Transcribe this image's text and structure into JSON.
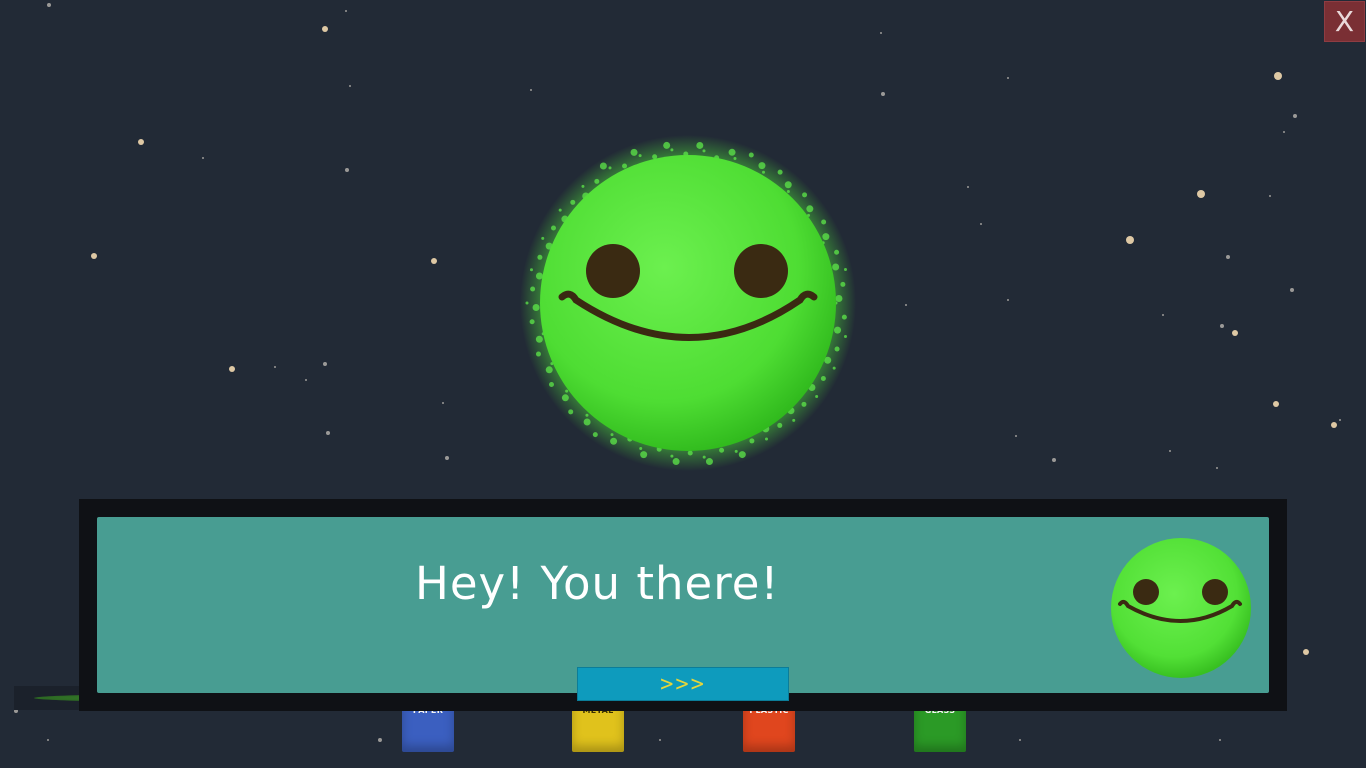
{
  "close_button": {
    "label": "X"
  },
  "dialog": {
    "message": "Hey! You there!",
    "next_label": ">>>"
  },
  "bins": [
    {
      "label": "PAPER",
      "color": "#3b5fc0"
    },
    {
      "label": "METAL",
      "color": "#e0c21c"
    },
    {
      "label": "PLASTIC",
      "color": "#e0461e"
    },
    {
      "label": "GLASS",
      "color": "#2b9a26"
    }
  ],
  "colors": {
    "background": "#222a36",
    "planet": "#53e83a",
    "dialog_panel": "#4ca89c",
    "next_button": "#0e9bbd",
    "next_arrow": "#e6d63a",
    "close_button": "#7a2f34"
  },
  "progress": {
    "fraction": 0.9
  }
}
